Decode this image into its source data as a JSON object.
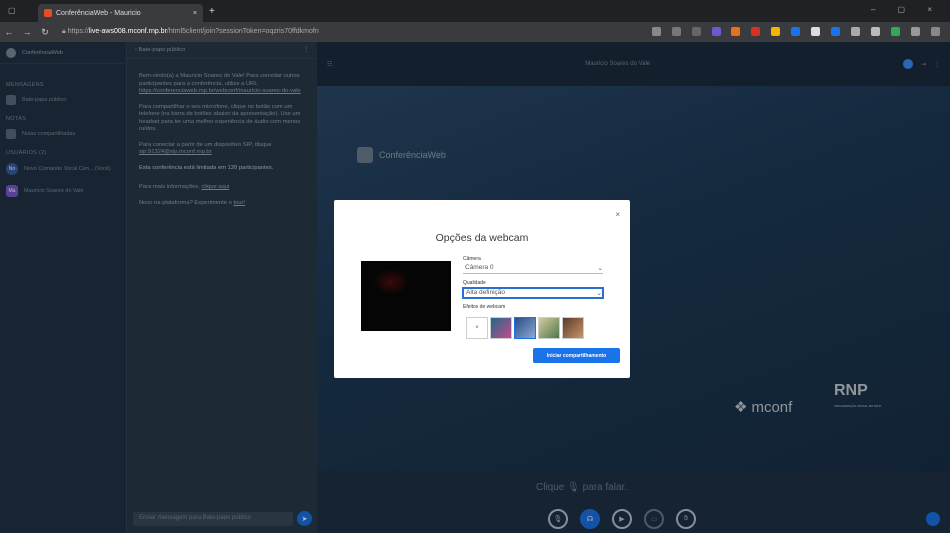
{
  "browser": {
    "tab_title": "ConferênciaWeb - Mauricio",
    "url_prefix": "https://",
    "url_host": "live-aws008.mconf.rnp.br",
    "url_path": "/html5client/join?sessionToken=oqzris70ffdkmofn"
  },
  "sidebar": {
    "brand": "ConferênciaWeb",
    "section_messages": "MENSAGENS",
    "public_chat": "Bate-papo público",
    "section_notes": "NOTAS",
    "shared_notes": "Notas compartilhadas",
    "section_users": "USUÁRIOS (2)",
    "users": [
      {
        "initials": "No",
        "name": "Novo Comando Vocal Cen... (Você)"
      },
      {
        "initials": "Ma",
        "name": "Mauricio Soares do Vale"
      }
    ]
  },
  "chat": {
    "header": "Bate-papo público",
    "messages": [
      "Bem-vindo(a) a Mauricio Soares do Vale! Para convidar outros participantes para a conferência, utilize a URL",
      "https://conferenciaweb.rnp.br/webconf/mauricio-soares-do-vale",
      "Para compartilhar o seu microfone, clique no botão com um telefone (na barra de botões abaixo da apresentação). Use um headset para ter uma melhor experiência de áudio com menos ruídos.",
      "Para conectar a partir de um dispositivo SIP, disque",
      "sip:91324@sip.mconf.rnp.br",
      "Esta conferência está limitada em 120 participantes.",
      "Para mais informações,",
      "clique aqui",
      "Novo na plataforma? Experimente o",
      "tour!"
    ],
    "input_placeholder": "Enviar mensagem para Bate-papo público"
  },
  "main": {
    "presenter_name": "Mauricio Soares do Vale",
    "logo_text": "ConferênciaWeb",
    "mconf": "mconf",
    "rnp": "RNP",
    "rnp_sub": "ORGANIZAÇÃO SOCIAL DO MCTI",
    "speak_hint": "Clique 🎙 para falar."
  },
  "modal": {
    "title": "Opções da webcam",
    "close": "×",
    "camera_label": "Câmera",
    "camera_value": "Câmera 0",
    "quality_label": "Qualidade",
    "quality_value": "Alta definição",
    "effects_label": "Efeitos de webcam",
    "no_effect": "×",
    "share_button": "Iniciar compartilhamento"
  },
  "colors": {
    "accent": "#1a73e8",
    "chrome": "#202124",
    "app_bg": "#1e3146"
  }
}
